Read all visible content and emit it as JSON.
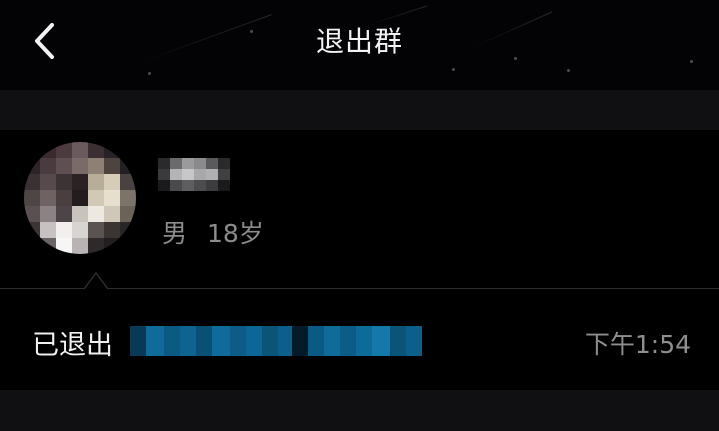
{
  "header": {
    "title": "退出群",
    "back_icon": "chevron-left-icon"
  },
  "profile": {
    "gender": "男",
    "age": "18岁",
    "avatar_note": "pixelated avatar",
    "name_hidden": true
  },
  "record": {
    "status_label": "已退出",
    "group_name_hidden": true,
    "time": "下午1:54"
  },
  "colors": {
    "background": "#000000",
    "band": "#101012",
    "title_text": "#f2f2f2",
    "secondary_text": "#8c8c8c",
    "mosaic_blue": "#0f6c9a"
  }
}
